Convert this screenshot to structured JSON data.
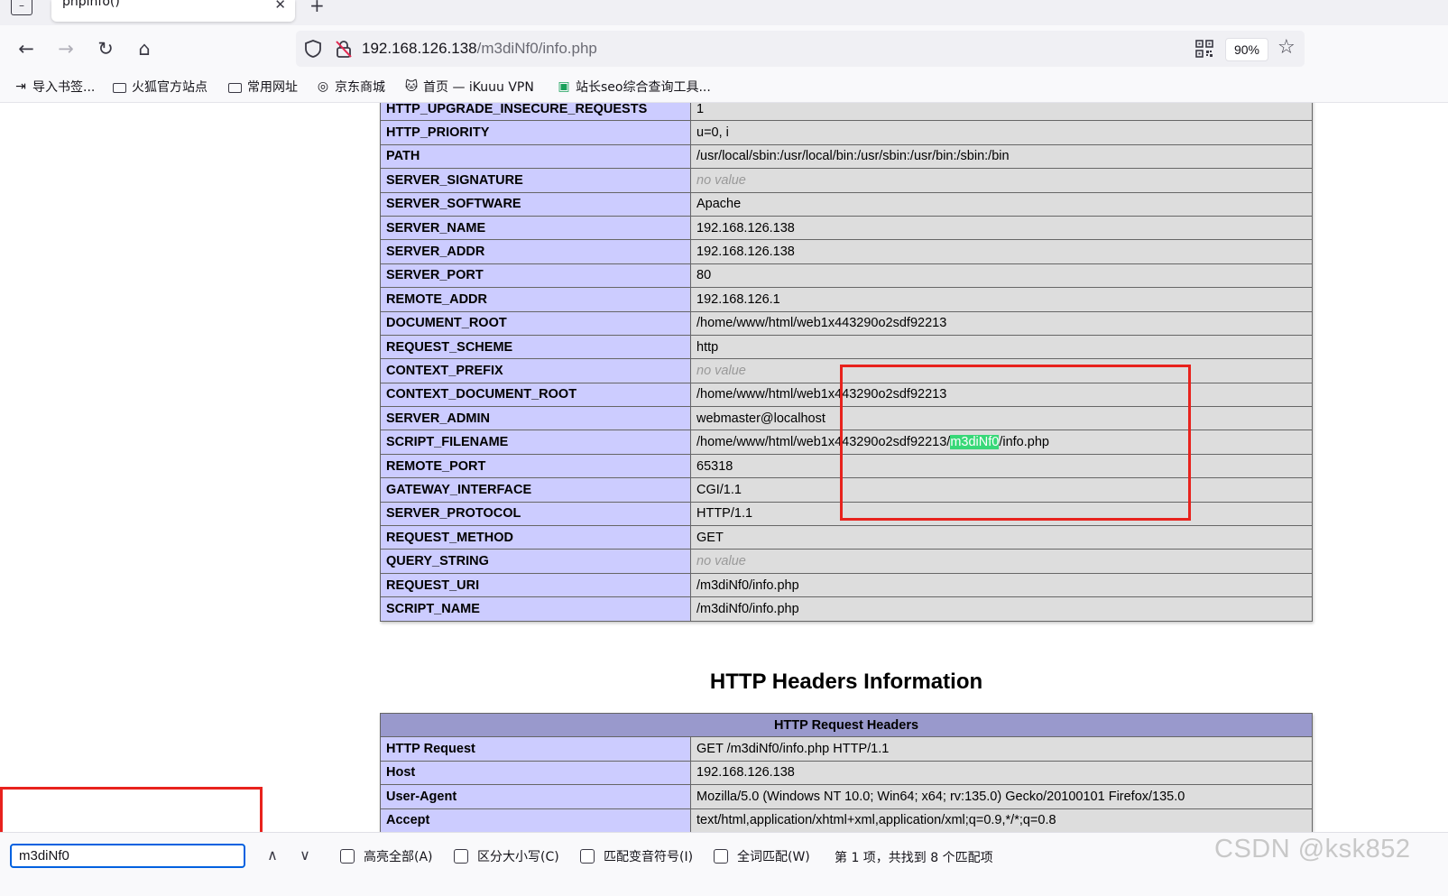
{
  "tab": {
    "title": "phpinfo()",
    "close": "✕",
    "new": "+"
  },
  "nav": {
    "back": "←",
    "forward": "→",
    "reload": "↻",
    "home": "⌂"
  },
  "urlbar": {
    "host": "192.168.126.138",
    "path": "/m3diNf0/info.php",
    "zoom": "90%",
    "star": "☆"
  },
  "bookmarks": [
    {
      "label": "导入书签...",
      "icon": "import-icon"
    },
    {
      "label": "火狐官方站点",
      "icon": "folder-icon"
    },
    {
      "label": "常用网址",
      "icon": "folder-icon"
    },
    {
      "label": "京东商城",
      "icon": "globe-icon"
    },
    {
      "label": "首页 — iKuuu VPN",
      "icon": "cat-icon"
    },
    {
      "label": "站长seo综合查询工具...",
      "icon": "seo-icon"
    }
  ],
  "env_rows": [
    {
      "key": "HTTP_UPGRADE_INSECURE_REQUESTS",
      "value": "1"
    },
    {
      "key": "HTTP_PRIORITY",
      "value": "u=0, i"
    },
    {
      "key": "PATH",
      "value": "/usr/local/sbin:/usr/local/bin:/usr/sbin:/usr/bin:/sbin:/bin"
    },
    {
      "key": "SERVER_SIGNATURE",
      "value": "no value",
      "novalue": true
    },
    {
      "key": "SERVER_SOFTWARE",
      "value": "Apache"
    },
    {
      "key": "SERVER_NAME",
      "value": "192.168.126.138"
    },
    {
      "key": "SERVER_ADDR",
      "value": "192.168.126.138"
    },
    {
      "key": "SERVER_PORT",
      "value": "80"
    },
    {
      "key": "REMOTE_ADDR",
      "value": "192.168.126.1"
    },
    {
      "key": "DOCUMENT_ROOT",
      "value": "/home/www/html/web1x443290o2sdf92213"
    },
    {
      "key": "REQUEST_SCHEME",
      "value": "http"
    },
    {
      "key": "CONTEXT_PREFIX",
      "value": "no value",
      "novalue": true
    },
    {
      "key": "CONTEXT_DOCUMENT_ROOT",
      "value": "/home/www/html/web1x443290o2sdf92213"
    },
    {
      "key": "SERVER_ADMIN",
      "value": "webmaster@localhost"
    },
    {
      "key": "SCRIPT_FILENAME",
      "value": "/home/www/html/web1x443290o2sdf92213/",
      "highlight": "m3diNf0",
      "suffix": "/info.php"
    },
    {
      "key": "REMOTE_PORT",
      "value": "65318"
    },
    {
      "key": "GATEWAY_INTERFACE",
      "value": "CGI/1.1"
    },
    {
      "key": "SERVER_PROTOCOL",
      "value": "HTTP/1.1"
    },
    {
      "key": "REQUEST_METHOD",
      "value": "GET"
    },
    {
      "key": "QUERY_STRING",
      "value": "no value",
      "novalue": true
    },
    {
      "key": "REQUEST_URI",
      "value": "/m3diNf0/info.php"
    },
    {
      "key": "SCRIPT_NAME",
      "value": "/m3diNf0/info.php"
    }
  ],
  "headers_section": {
    "title": "HTTP Headers Information",
    "table_header": "HTTP Request Headers",
    "rows": [
      {
        "key": "HTTP Request",
        "value": "GET /m3diNf0/info.php HTTP/1.1"
      },
      {
        "key": "Host",
        "value": "192.168.126.138"
      },
      {
        "key": "User-Agent",
        "value": "Mozilla/5.0 (Windows NT 10.0; Win64; x64; rv:135.0) Gecko/20100101 Firefox/135.0"
      },
      {
        "key": "Accept",
        "value": "text/html,application/xhtml+xml,application/xml;q=0.9,*/*;q=0.8"
      }
    ]
  },
  "findbar": {
    "query": "m3diNf0",
    "up": "∧",
    "down": "∨",
    "options": [
      "高亮全部(A)",
      "区分大小写(C)",
      "匹配变音符号(I)",
      "全词匹配(W)"
    ],
    "status": "第 1 项，共找到 8 个匹配项"
  },
  "watermark": "CSDN @ksk852",
  "colors": {
    "annotation_red": "#e8221d",
    "match_highlight": "#38d878",
    "php_key": "#ccccff",
    "php_value": "#dddddd",
    "php_header": "#9999cc"
  }
}
